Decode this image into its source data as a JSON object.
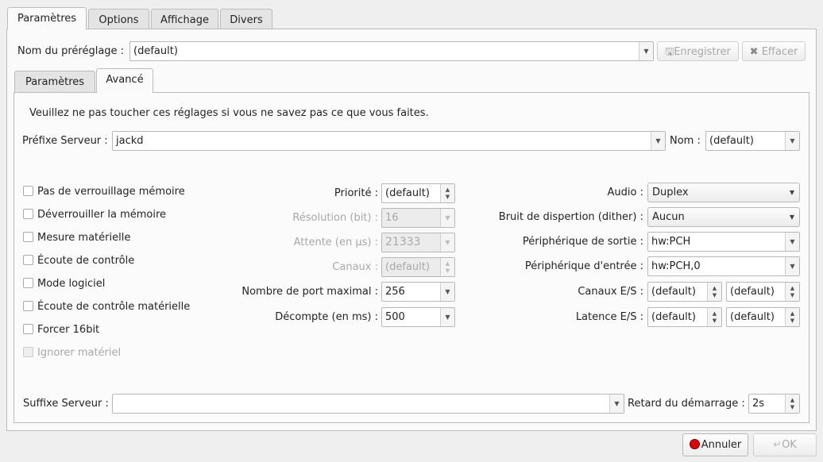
{
  "top_tabs": [
    "Paramètres",
    "Options",
    "Affichage",
    "Divers"
  ],
  "preset": {
    "label": "Nom du préréglage :",
    "value": "(default)",
    "save": "Enregistrer",
    "delete": "Effacer"
  },
  "inner_tabs": [
    "Paramètres",
    "Avancé"
  ],
  "warning": "Veuillez ne pas toucher ces réglages si vous ne savez pas ce que vous faites.",
  "server_prefix": {
    "label": "Préfixe Serveur :",
    "value": "jackd",
    "name_label": "Nom :",
    "name_value": "(default)"
  },
  "checkboxes": [
    {
      "label": "Pas de verrouillage mémoire",
      "checked": false,
      "enabled": true
    },
    {
      "label": "Déverrouiller la mémoire",
      "checked": false,
      "enabled": true
    },
    {
      "label": "Mesure matérielle",
      "checked": false,
      "enabled": true
    },
    {
      "label": "Écoute de contrôle",
      "checked": false,
      "enabled": true
    },
    {
      "label": "Mode logiciel",
      "checked": false,
      "enabled": true
    },
    {
      "label": "Écoute de contrôle matérielle",
      "checked": false,
      "enabled": true
    },
    {
      "label": "Forcer 16bit",
      "checked": false,
      "enabled": true
    },
    {
      "label": "Ignorer matériel",
      "checked": false,
      "enabled": false
    }
  ],
  "middle": [
    {
      "label": "Priorité :",
      "value": "(default)"
    },
    {
      "label": "Résolution (bit) :",
      "value": "16"
    },
    {
      "label": "Attente (en µs) :",
      "value": "21333"
    },
    {
      "label": "Canaux :",
      "value": "(default)"
    },
    {
      "label": "Nombre de port maximal :",
      "value": "256"
    },
    {
      "label": "Décompte (en ms) :",
      "value": "500"
    }
  ],
  "right": [
    {
      "label": "Audio :",
      "value": "Duplex"
    },
    {
      "label": "Bruit de dispertion (dither) :",
      "value": "Aucun"
    },
    {
      "label": "Périphérique de sortie :",
      "value": "hw:PCH"
    },
    {
      "label": "Périphérique d'entrée :",
      "value": "hw:PCH,0"
    },
    {
      "label": "Canaux E/S :",
      "value_in": "(default)",
      "value_out": "(default)"
    },
    {
      "label": "Latence E/S :",
      "value_in": "(default)",
      "value_out": "(default)"
    }
  ],
  "suffix": {
    "label": "Suffixe Serveur :",
    "value": "",
    "delay_label": "Retard du démarrage :",
    "delay_value": "2s"
  },
  "buttons": {
    "cancel": "Annuler",
    "ok": "OK"
  }
}
